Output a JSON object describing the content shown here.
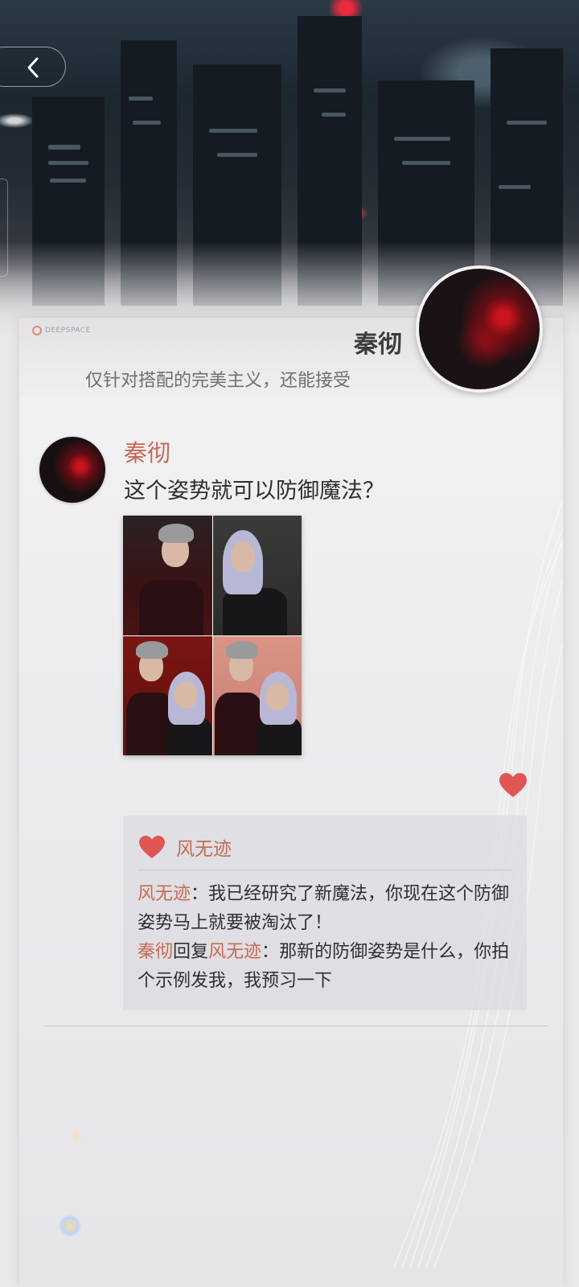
{
  "header": {
    "brand": "DEEPSPACE",
    "name": "秦彻",
    "signature": "仅针对搭配的完美主义，还能接受"
  },
  "post": {
    "author": "秦彻",
    "text": "这个姿势就可以防御魔法？"
  },
  "likes": {
    "name": "风无迹"
  },
  "comments": [
    {
      "author": "风无迹",
      "reply_word": "",
      "reply_to": "",
      "sep": "：",
      "text": "我已经研究了新魔法，你现在这个防御姿势马上就要被淘汰了！"
    },
    {
      "author": "秦彻",
      "reply_word": "回复",
      "reply_to": "风无迹",
      "sep": "：",
      "text": "那新的防御姿势是什么，你拍个示例发我，我预习一下"
    }
  ],
  "colors": {
    "accent": "#c66a52",
    "heart": "#e25555",
    "text": "#2e2e33"
  },
  "icons": {
    "back": "chevron-left-icon",
    "like": "heart-icon"
  }
}
